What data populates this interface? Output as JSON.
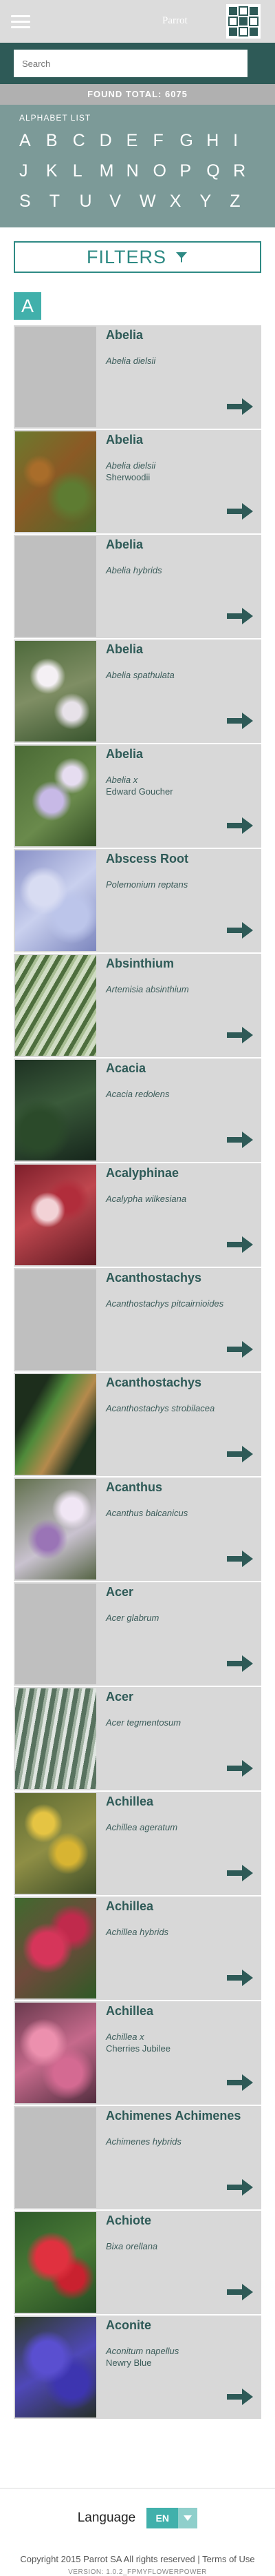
{
  "header": {
    "brand": "Parrot",
    "menu_icon": "hamburger-icon",
    "logo_icon": "parrot-logo-icon"
  },
  "search": {
    "placeholder": "Search"
  },
  "found_total": "FOUND TOTAL: 6075",
  "alphabet": {
    "title": "ALPHABET LIST",
    "rows": [
      [
        "A",
        "B",
        "C",
        "D",
        "E",
        "F",
        "G",
        "H",
        "I"
      ],
      [
        "J",
        "K",
        "L",
        "M",
        "N",
        "O",
        "P",
        "Q",
        "R"
      ],
      [
        "S",
        "T",
        "U",
        "V",
        "W",
        "X",
        "Y",
        "Z"
      ]
    ]
  },
  "filters": {
    "label": "FILTERS",
    "icon": "funnel-icon"
  },
  "current_letter": "A",
  "plants": [
    {
      "name": "Abelia",
      "latin": "Abelia dielsii",
      "cultivar": "",
      "image": "placeholder"
    },
    {
      "name": "Abelia",
      "latin": "Abelia dielsii",
      "cultivar": "Sherwoodii",
      "image": "photo"
    },
    {
      "name": "Abelia",
      "latin": "Abelia hybrids",
      "cultivar": "",
      "image": "placeholder"
    },
    {
      "name": "Abelia",
      "latin": "Abelia spathulata",
      "cultivar": "",
      "image": "photo"
    },
    {
      "name": "Abelia",
      "latin": "Abelia x",
      "cultivar": "Edward Goucher",
      "image": "photo"
    },
    {
      "name": "Abscess Root",
      "latin": "Polemonium reptans",
      "cultivar": "",
      "image": "photo"
    },
    {
      "name": "Absinthium",
      "latin": "Artemisia absinthium",
      "cultivar": "",
      "image": "photo"
    },
    {
      "name": "Acacia",
      "latin": "Acacia redolens",
      "cultivar": "",
      "image": "photo"
    },
    {
      "name": "Acalyphinae",
      "latin": "Acalypha wilkesiana",
      "cultivar": "",
      "image": "photo"
    },
    {
      "name": "Acanthostachys",
      "latin": "Acanthostachys pitcairnioides",
      "cultivar": "",
      "image": "placeholder"
    },
    {
      "name": "Acanthostachys",
      "latin": "Acanthostachys strobilacea",
      "cultivar": "",
      "image": "photo"
    },
    {
      "name": "Acanthus",
      "latin": "Acanthus balcanicus",
      "cultivar": "",
      "image": "photo"
    },
    {
      "name": "Acer",
      "latin": "Acer glabrum",
      "cultivar": "",
      "image": "placeholder"
    },
    {
      "name": "Acer",
      "latin": "Acer tegmentosum",
      "cultivar": "",
      "image": "photo"
    },
    {
      "name": "Achillea",
      "latin": "Achillea ageratum",
      "cultivar": "",
      "image": "photo"
    },
    {
      "name": "Achillea",
      "latin": "Achillea hybrids",
      "cultivar": "",
      "image": "photo"
    },
    {
      "name": "Achillea",
      "latin": "Achillea x",
      "cultivar": "Cherries Jubilee",
      "image": "photo"
    },
    {
      "name": "Achimenes Achimenes",
      "latin": "Achimenes hybrids",
      "cultivar": "",
      "image": "placeholder"
    },
    {
      "name": "Achiote",
      "latin": "Bixa orellana",
      "cultivar": "",
      "image": "photo"
    },
    {
      "name": "Aconite",
      "latin": "Aconitum napellus",
      "cultivar": "Newry Blue",
      "image": "photo"
    }
  ],
  "footer": {
    "language_label": "Language",
    "language_value": "EN",
    "copyright": "Copyright 2015 Parrot SA All rights reserved",
    "separator": " | ",
    "terms_link": "Terms of Use",
    "version": "VERSION: 1.0.2_FPMYFLOWERPOWER"
  },
  "colors": {
    "dark_teal": "#2e5a57",
    "teal_accent": "#41b0ab",
    "alphabet_bg": "#7c9a98",
    "found_bg": "#b0b0b0",
    "card_bg": "#d8d8d8"
  }
}
